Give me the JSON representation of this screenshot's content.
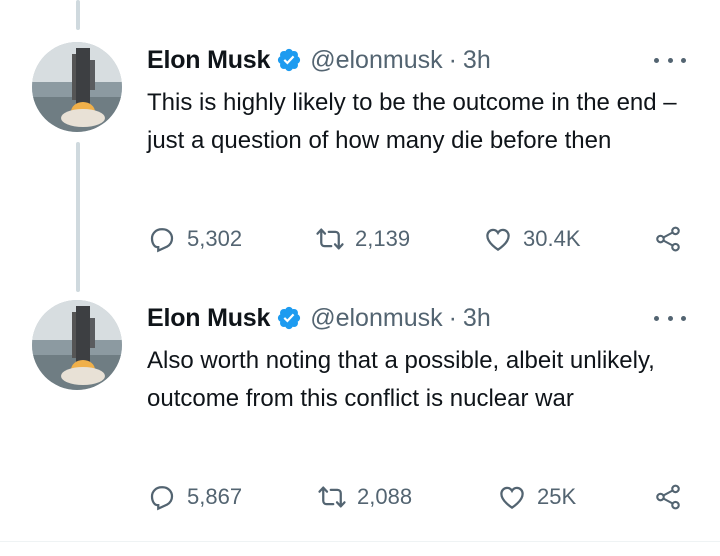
{
  "tweets": [
    {
      "author_name": "Elon Musk",
      "handle": "@elonmusk",
      "separator": "·",
      "time": "3h",
      "text": "This is highly likely to be the outcome in the end – just a question of how many die before then",
      "replies": "5,302",
      "retweets": "2,139",
      "likes": "30.4K"
    },
    {
      "author_name": "Elon Musk",
      "handle": "@elonmusk",
      "separator": "·",
      "time": "3h",
      "text": "Also worth noting that a possible, albeit unlikely, outcome from this conflict is nuclear war",
      "replies": "5,867",
      "retweets": "2,088",
      "likes": "25K"
    }
  ],
  "icons": {
    "verified": "verified-badge-icon",
    "more": "more-options-icon",
    "reply": "reply-icon",
    "retweet": "retweet-icon",
    "like": "heart-icon",
    "share": "share-icon"
  },
  "colors": {
    "verified_blue": "#1d9bf0",
    "secondary_text": "#536471",
    "thread_line": "#cfd9de"
  }
}
